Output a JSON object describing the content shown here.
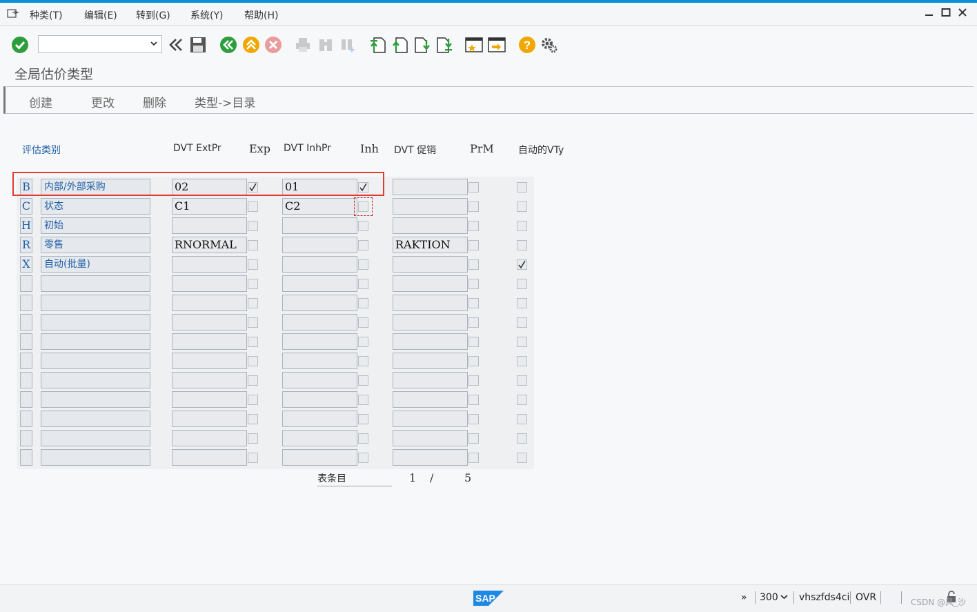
{
  "menubar": {
    "items": [
      "种类(T)",
      "编辑(E)",
      "转到(G)",
      "系统(Y)",
      "帮助(H)"
    ]
  },
  "toolbar": {
    "command_value": "",
    "icons": [
      "enter-icon",
      "command-dropdown-icon",
      "collapse-icon",
      "save-icon",
      "back-icon",
      "exit-icon",
      "cancel-icon",
      "print-icon",
      "find-icon",
      "find-next-icon",
      "first-page-icon",
      "previous-page-icon",
      "next-page-icon",
      "last-page-icon",
      "create-session-icon",
      "shortcut-icon",
      "help-icon",
      "settings-icon"
    ]
  },
  "page": {
    "title": "全局估价类型"
  },
  "appbar": {
    "buttons": [
      "创建",
      "更改",
      "删除",
      "类型->目录"
    ]
  },
  "table": {
    "headers": {
      "category": "评估类别",
      "dvt_extpr": "DVT ExtPr",
      "exp": "Exp",
      "dvt_inhpr": "DVT InhPr",
      "inh": "Inh",
      "dvt_promo": "DVT 促销",
      "prm": "PrM",
      "auto_vty": "自动的VTy"
    },
    "rows": [
      {
        "key": "B",
        "desc": "内部/外部采购",
        "extpr": "02",
        "exp": true,
        "inhpr": "01",
        "inh": true,
        "promo": "",
        "prm": false,
        "auto": false
      },
      {
        "key": "C",
        "desc": "状态",
        "extpr": "C1",
        "exp": false,
        "inhpr": "C2",
        "inh": false,
        "promo": "",
        "prm": false,
        "auto": false
      },
      {
        "key": "H",
        "desc": "初始",
        "extpr": "",
        "exp": false,
        "inhpr": "",
        "inh": false,
        "promo": "",
        "prm": false,
        "auto": false
      },
      {
        "key": "R",
        "desc": "零售",
        "extpr": "RNORMAL",
        "exp": false,
        "inhpr": "",
        "inh": false,
        "promo": "RAKTION",
        "prm": false,
        "auto": false
      },
      {
        "key": "X",
        "desc": "自动(批量)",
        "extpr": "",
        "exp": false,
        "inhpr": "",
        "inh": false,
        "promo": "",
        "prm": false,
        "auto": true
      },
      {
        "key": "",
        "desc": "",
        "extpr": "",
        "exp": false,
        "inhpr": "",
        "inh": false,
        "promo": "",
        "prm": false,
        "auto": false
      },
      {
        "key": "",
        "desc": "",
        "extpr": "",
        "exp": false,
        "inhpr": "",
        "inh": false,
        "promo": "",
        "prm": false,
        "auto": false
      },
      {
        "key": "",
        "desc": "",
        "extpr": "",
        "exp": false,
        "inhpr": "",
        "inh": false,
        "promo": "",
        "prm": false,
        "auto": false
      },
      {
        "key": "",
        "desc": "",
        "extpr": "",
        "exp": false,
        "inhpr": "",
        "inh": false,
        "promo": "",
        "prm": false,
        "auto": false
      },
      {
        "key": "",
        "desc": "",
        "extpr": "",
        "exp": false,
        "inhpr": "",
        "inh": false,
        "promo": "",
        "prm": false,
        "auto": false
      },
      {
        "key": "",
        "desc": "",
        "extpr": "",
        "exp": false,
        "inhpr": "",
        "inh": false,
        "promo": "",
        "prm": false,
        "auto": false
      },
      {
        "key": "",
        "desc": "",
        "extpr": "",
        "exp": false,
        "inhpr": "",
        "inh": false,
        "promo": "",
        "prm": false,
        "auto": false
      },
      {
        "key": "",
        "desc": "",
        "extpr": "",
        "exp": false,
        "inhpr": "",
        "inh": false,
        "promo": "",
        "prm": false,
        "auto": false
      },
      {
        "key": "",
        "desc": "",
        "extpr": "",
        "exp": false,
        "inhpr": "",
        "inh": false,
        "promo": "",
        "prm": false,
        "auto": false
      },
      {
        "key": "",
        "desc": "",
        "extpr": "",
        "exp": false,
        "inhpr": "",
        "inh": false,
        "promo": "",
        "prm": false,
        "auto": false
      }
    ]
  },
  "pager": {
    "label": "表条目",
    "current": "1",
    "separator": "/",
    "total": "5"
  },
  "statusbar": {
    "expand": "»",
    "client": "300",
    "server": "vhszfds4ci",
    "mode": "OVR",
    "watermark": "CSDN @风_沙"
  },
  "colors": {
    "accent": "#0a8fd8",
    "highlight_box": "#e53935",
    "link_blue": "#1f5fa8",
    "ok_green": "#2e9e3c",
    "nav_yellow": "#f0a800",
    "cancel_red": "#e05050"
  }
}
